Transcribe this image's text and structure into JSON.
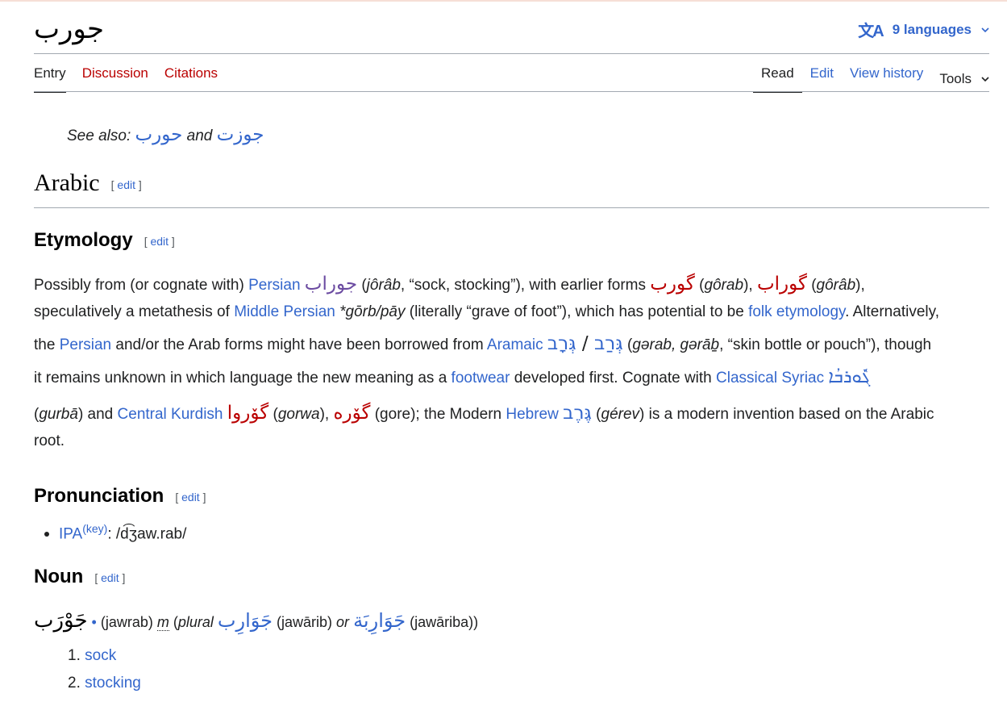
{
  "header": {
    "title": "جورب",
    "languages_label": "9 languages",
    "tabs_left": [
      "Entry",
      "Discussion",
      "Citations"
    ],
    "tabs_right": [
      "Read",
      "Edit",
      "View history",
      "Tools"
    ]
  },
  "see_also": {
    "label": "See also:",
    "item1": "حورب",
    "conj": "and",
    "item2": "جوزت"
  },
  "sections": {
    "language": "Arabic",
    "etymology": "Etymology",
    "pronunciation": "Pronunciation",
    "noun": "Noun",
    "edit_label": "edit"
  },
  "etymology": {
    "l1": {
      "t1": "Possibly from (or cognate with) ",
      "persian": "Persian",
      "w1": "جوراب",
      "t2": " (",
      "tr1": "jôrâb",
      "t3": ", “sock, stocking”), with earlier forms ",
      "w2": "گورب",
      "t4": " (",
      "tr2": "gôrab",
      "t5": "), ",
      "w3": "گوراب",
      "t6": " (",
      "tr3": "gôrâb",
      "t7": "),"
    },
    "l2": {
      "t1": "speculatively a metathesis of ",
      "mp": "Middle Persian",
      "t2": " ",
      "form": "*gōrb/pāy",
      "t3": " (literally “grave of foot”), which has potential to be ",
      "fe": "folk etymology",
      "t4": ". Alternatively,"
    },
    "l3": {
      "t1": "the ",
      "persian": "Persian",
      "t2": " and/or the Arab forms might have been borrowed from ",
      "aramaic": "Aramaic",
      "t3": " ",
      "h1": "גְּרַב",
      "slash": " / ",
      "h2": "גְּרָב",
      "t4": " (",
      "tr": "gərab, gərāḇ",
      "t5": ", “skin bottle or pouch”), though"
    },
    "l4": {
      "t1": "it remains unknown in which language the new meaning as a ",
      "footwear": "footwear",
      "t2": " developed first. Cognate with ",
      "syriac": "Classical Syriac",
      "t3": " ",
      "syr": "ܓܽܘܪܒܳܐ"
    },
    "l5": {
      "t1": "(",
      "tr1": "gurbā",
      "t2": ") and ",
      "ck": "Central Kurdish",
      "t3": " ",
      "w1": "گۆروا",
      "t4": " (",
      "tr2": "gorwa",
      "t5": "), ",
      "w2": "گۆرە",
      "t6": " (gore); the Modern ",
      "hebrew": "Hebrew",
      "t7": " ",
      "h": "גֶּרֶב",
      "t8": " (",
      "tr3": "gérev",
      "t9": ") is a modern invention based on the Arabic"
    },
    "l6": "root."
  },
  "pronunciation": {
    "ipa": "IPA",
    "key": "(key)",
    "colon": ": ",
    "value": "/d͡ʒaw.rab/"
  },
  "noun": {
    "headword": "جَوْرَب",
    "dot": " • ",
    "translit": "(jawrab) ",
    "gender": "m",
    "open": " (",
    "plural_label": "plural",
    "pl1": "جَوَارِب",
    "pl1_tr": " (jawārib) ",
    "or": "or",
    "pl2": "جَوَارِبَة",
    "pl2_tr": " (jawāriba))"
  },
  "senses": [
    "sock",
    "stocking"
  ]
}
